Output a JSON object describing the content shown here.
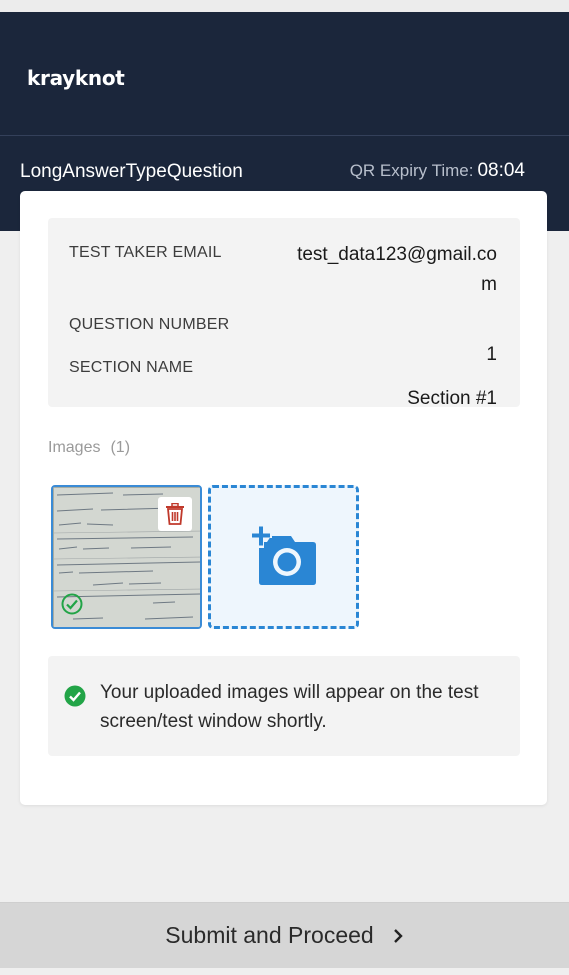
{
  "header": {
    "logo_text": "krayknot",
    "question_type": "LongAnswerTypeQuestion",
    "qr_expiry_label": "QR Expiry Time:",
    "qr_expiry_time": "08:04",
    "background_color": "#1b263b"
  },
  "info": {
    "email_label": "TEST TAKER EMAIL",
    "email_value": "test_data123@gmail.com",
    "question_number_label": "QUESTION NUMBER",
    "question_number_value": "1",
    "section_name_label": "SECTION NAME",
    "section_name_value": "Section #1"
  },
  "images": {
    "label": "Images",
    "count": "(1)",
    "uploaded": [
      {
        "status": "uploaded",
        "icon": "check-circle-icon",
        "delete_icon": "trash-icon"
      }
    ],
    "add_icon": "add-photo-icon",
    "accent_color": "#2a86d4"
  },
  "notice": {
    "icon": "check-circle-icon",
    "text": "Your uploaded images will appear on the test screen/test window shortly.",
    "icon_color": "#22a447"
  },
  "footer": {
    "submit_label": "Submit and Proceed",
    "submit_icon": "chevron-right-icon"
  }
}
